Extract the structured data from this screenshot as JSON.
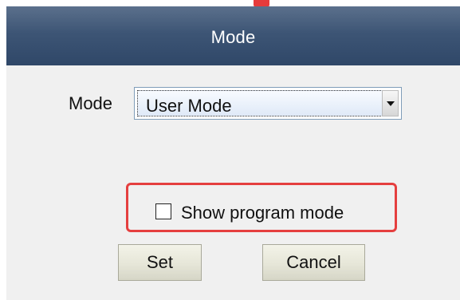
{
  "window": {
    "title": "Mode"
  },
  "mode_row": {
    "label": "Mode",
    "selected_value": "User Mode"
  },
  "checkbox": {
    "label": "Show program mode",
    "checked": false
  },
  "buttons": {
    "set_label": "Set",
    "cancel_label": "Cancel"
  },
  "colors": {
    "titlebar": "#3d5575",
    "highlight": "#e53f3f",
    "dialog_background": "#f0f0f0"
  },
  "icons": {
    "dropdown_arrow": "chevron-down-icon"
  }
}
